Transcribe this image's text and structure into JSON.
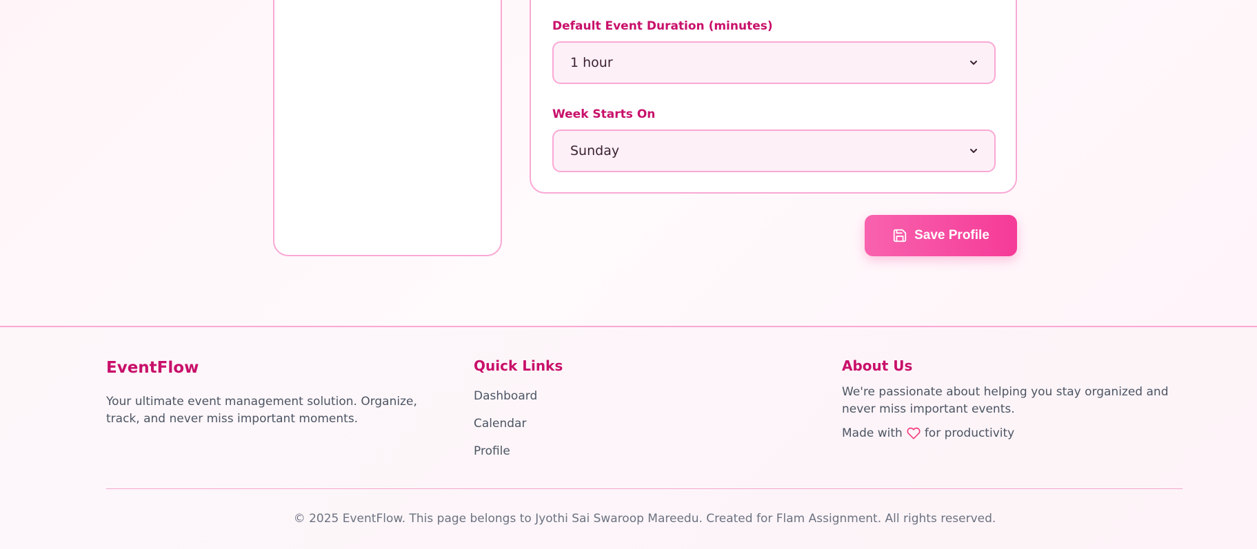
{
  "settings": {
    "duration": {
      "label": "Default Event Duration (minutes)",
      "value": "1 hour"
    },
    "week_start": {
      "label": "Week Starts On",
      "value": "Sunday"
    },
    "save_label": "Save Profile"
  },
  "footer": {
    "brand": "EventFlow",
    "brand_description": "Your ultimate event management solution. Organize, track, and never miss important moments.",
    "quick_links": {
      "title": "Quick Links",
      "items": [
        "Dashboard",
        "Calendar",
        "Profile"
      ]
    },
    "about": {
      "title": "About Us",
      "text": "We're passionate about helping you stay organized and never miss important events.",
      "made_with_prefix": "Made with",
      "made_with_suffix": "for productivity"
    },
    "copyright": "© 2025 EventFlow. This page belongs to Jyothi Sai Swaroop Mareedu. Created for Flam Assignment. All rights reserved."
  },
  "colors": {
    "accent": "#c8106a",
    "border": "#f9a8d4",
    "button": "#f53b97"
  },
  "icons": {
    "save": "save-icon",
    "heart": "heart-icon",
    "chevron": "chevron-down-icon"
  }
}
